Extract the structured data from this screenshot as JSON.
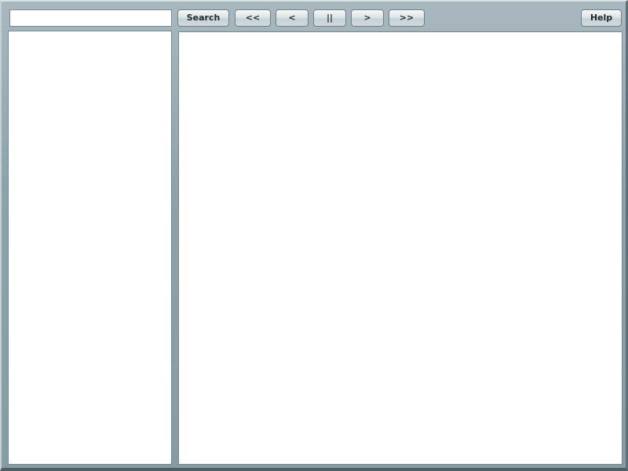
{
  "toolbar": {
    "search_placeholder": "",
    "search_label": "Search",
    "first_label": "<<",
    "prev_label": "<",
    "pause_label": "||",
    "next_label": ">",
    "last_label": ">>",
    "help_label": "Help"
  },
  "colors": {
    "frame": "#8ea0a8",
    "panel": "#ffffff",
    "button_text": "#1e2a30"
  }
}
